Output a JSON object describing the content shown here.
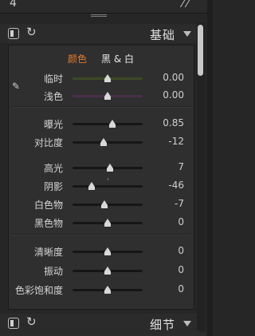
{
  "topbar": {
    "glyph": "4",
    "tools": "⁄ ⁄"
  },
  "basic": {
    "title": "基础"
  },
  "modes": {
    "color": "颜色",
    "bw": "黑 & 白"
  },
  "sliders": {
    "temp": {
      "label": "临时",
      "value": "0.00",
      "pos": 0.5
    },
    "tint": {
      "label": "浅色",
      "value": "0.00",
      "pos": 0.5
    },
    "exposure": {
      "label": "曝光",
      "value": "0.85",
      "pos": 0.57
    },
    "contrast": {
      "label": "对比度",
      "value": "-12",
      "pos": 0.44
    },
    "highlights": {
      "label": "高光",
      "value": "7",
      "pos": 0.53
    },
    "shadows": {
      "label": "阴影",
      "value": "-46",
      "pos": 0.27
    },
    "whites": {
      "label": "白色物",
      "value": "-7",
      "pos": 0.46
    },
    "blacks": {
      "label": "黑色物",
      "value": "0",
      "pos": 0.5
    },
    "clarity": {
      "label": "清晰度",
      "value": "0",
      "pos": 0.5
    },
    "vibrance": {
      "label": "振动",
      "value": "0",
      "pos": 0.5
    },
    "saturation": {
      "label": "色彩饱和度",
      "value": "0",
      "pos": 0.5
    }
  },
  "colors": {
    "temp_track": "#556b2f",
    "tint_track": "#6b3f6b",
    "accent": "#e07a32"
  },
  "detail": {
    "title": "细节"
  }
}
